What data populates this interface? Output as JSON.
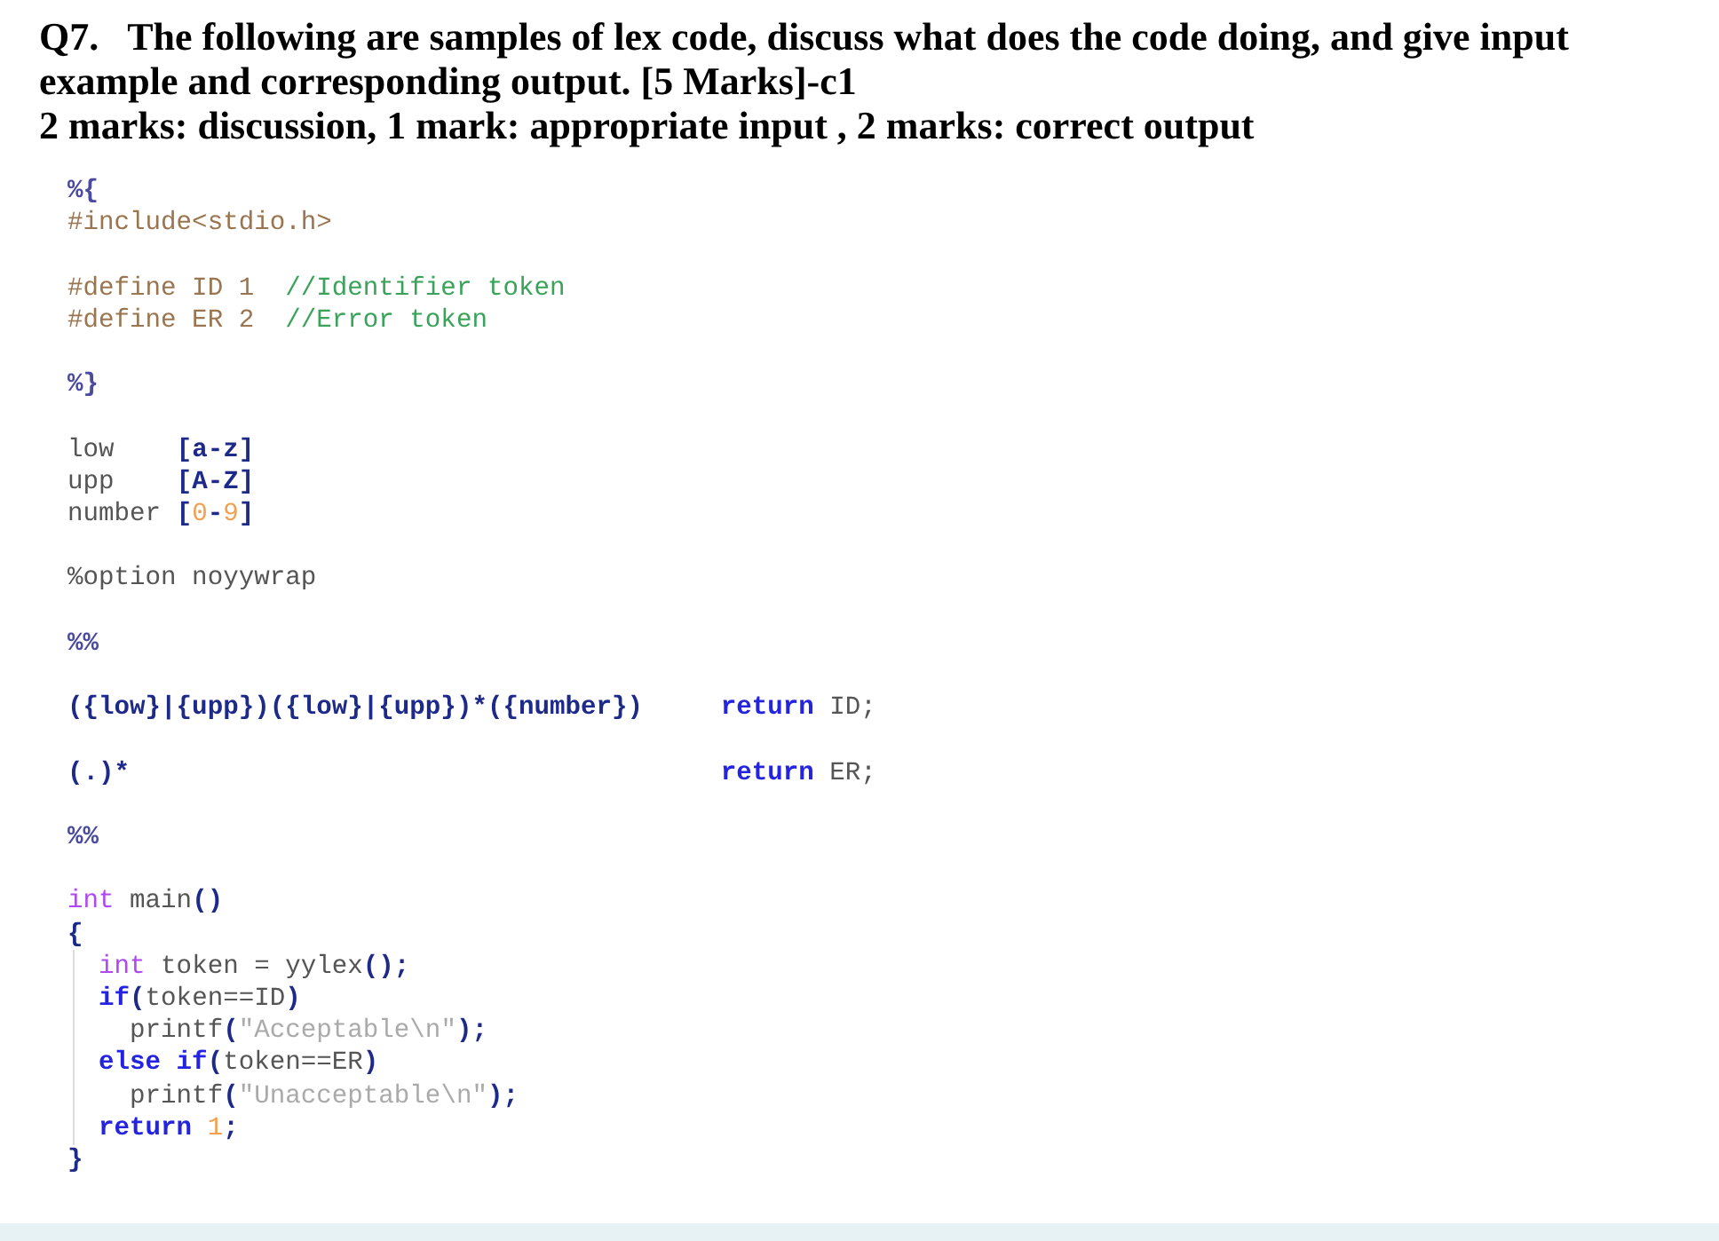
{
  "question": {
    "number": "Q7.",
    "text": "The following are samples of lex code, discuss what does the code doing, and give input example and corresponding output. [5 Marks]-c1",
    "marking": "2 marks: discussion, 1 mark: appropriate input ,  2 marks: correct output"
  },
  "code_blocks": [
    {
      "lines": [
        [
          {
            "text": "%{",
            "kind": "percent"
          }
        ],
        [
          {
            "text": "#include<stdio.h>",
            "kind": "directive"
          }
        ]
      ]
    },
    {
      "lines": [
        [
          {
            "text": "#define ID 1  ",
            "kind": "directive"
          },
          {
            "text": "//Identifier token",
            "kind": "comment"
          }
        ],
        [
          {
            "text": "#define ER 2  ",
            "kind": "directive"
          },
          {
            "text": "//Error token",
            "kind": "comment"
          }
        ]
      ]
    },
    {
      "lines": [
        [
          {
            "text": "%}",
            "kind": "percent"
          }
        ]
      ]
    },
    {
      "lines": [
        [
          {
            "text": "low    ",
            "kind": "plain"
          },
          {
            "text": "[a-z]",
            "kind": "bracket"
          }
        ],
        [
          {
            "text": "upp    ",
            "kind": "plain"
          },
          {
            "text": "[A-Z]",
            "kind": "bracket"
          }
        ],
        [
          {
            "text": "number ",
            "kind": "plain"
          },
          {
            "text": "[",
            "kind": "bracket"
          },
          {
            "text": "0",
            "kind": "number"
          },
          {
            "text": "-",
            "kind": "bracket"
          },
          {
            "text": "9",
            "kind": "number"
          },
          {
            "text": "]",
            "kind": "bracket"
          }
        ]
      ]
    },
    {
      "lines": [
        [
          {
            "text": "%option noyywrap",
            "kind": "plain"
          }
        ]
      ]
    },
    {
      "lines": [
        [
          {
            "text": "%%",
            "kind": "percent"
          }
        ]
      ]
    },
    {
      "lines": [
        [
          {
            "text": "({low}|{upp})({low}|{upp})*({number})     ",
            "kind": "bracket"
          },
          {
            "text": "return",
            "kind": "keyword"
          },
          {
            "text": " ID;",
            "kind": "plain"
          }
        ]
      ]
    },
    {
      "lines": [
        [
          {
            "text": "(.)*                                      ",
            "kind": "bracket"
          },
          {
            "text": "return",
            "kind": "keyword"
          },
          {
            "text": " ER;",
            "kind": "plain"
          }
        ]
      ]
    },
    {
      "lines": [
        [
          {
            "text": "%%",
            "kind": "percent"
          }
        ]
      ]
    },
    {
      "lines": [
        [
          {
            "text": "int",
            "kind": "type"
          },
          {
            "text": " main",
            "kind": "plain"
          },
          {
            "text": "()",
            "kind": "bracket"
          }
        ],
        [
          {
            "text": "{",
            "kind": "bracket"
          }
        ],
        [
          {
            "text": "  int",
            "kind": "type"
          },
          {
            "text": " token = yylex",
            "kind": "plain"
          },
          {
            "text": "();",
            "kind": "bracket"
          }
        ],
        [
          {
            "text": "  if",
            "kind": "keyword"
          },
          {
            "text": "(",
            "kind": "bracket"
          },
          {
            "text": "token==ID",
            "kind": "plain"
          },
          {
            "text": ")",
            "kind": "bracket"
          }
        ],
        [
          {
            "text": "    printf",
            "kind": "plain"
          },
          {
            "text": "(",
            "kind": "bracket"
          },
          {
            "text": "\"Acceptable\\n\"",
            "kind": "string"
          },
          {
            "text": ");",
            "kind": "bracket"
          }
        ],
        [
          {
            "text": "  else if",
            "kind": "keyword"
          },
          {
            "text": "(",
            "kind": "bracket"
          },
          {
            "text": "token==ER",
            "kind": "plain"
          },
          {
            "text": ")",
            "kind": "bracket"
          }
        ],
        [
          {
            "text": "    printf",
            "kind": "plain"
          },
          {
            "text": "(",
            "kind": "bracket"
          },
          {
            "text": "\"Unacceptable\\n\"",
            "kind": "string"
          },
          {
            "text": ");",
            "kind": "bracket"
          }
        ],
        [
          {
            "text": "  return",
            "kind": "keyword"
          },
          {
            "text": " 1",
            "kind": "number"
          },
          {
            "text": ";",
            "kind": "bracket"
          }
        ],
        [
          {
            "text": "}",
            "kind": "bracket"
          }
        ]
      ]
    }
  ]
}
